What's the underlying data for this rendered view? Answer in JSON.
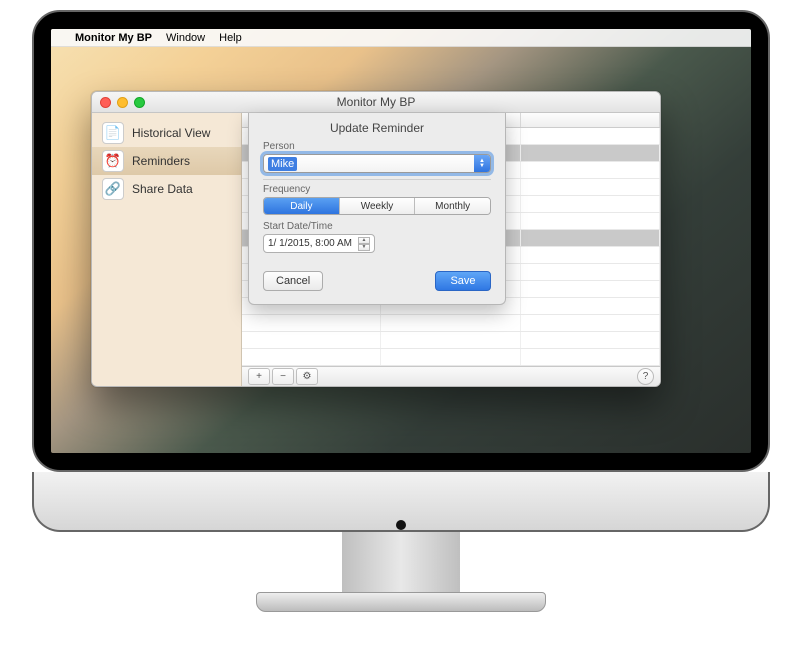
{
  "menubar": {
    "apple": "",
    "app": "Monitor My BP",
    "items": [
      "Window",
      "Help"
    ]
  },
  "window": {
    "title": "Monitor My BP",
    "sidebar": {
      "items": [
        {
          "icon": "📄",
          "label": "Historical View"
        },
        {
          "icon": "⏰",
          "label": "Reminders"
        },
        {
          "icon": "🔗",
          "label": "Share Data"
        }
      ],
      "selected_index": 1
    },
    "footer": {
      "add": "+",
      "remove": "−",
      "action": "⚙",
      "help": "?"
    }
  },
  "sheet": {
    "title": "Update Reminder",
    "person_label": "Person",
    "person_value": "Mike",
    "frequency_label": "Frequency",
    "frequency_options": [
      "Daily",
      "Weekly",
      "Monthly"
    ],
    "frequency_selected": 0,
    "start_label": "Start Date/Time",
    "start_value": "1/ 1/2015,  8:00 AM",
    "cancel": "Cancel",
    "save": "Save"
  }
}
